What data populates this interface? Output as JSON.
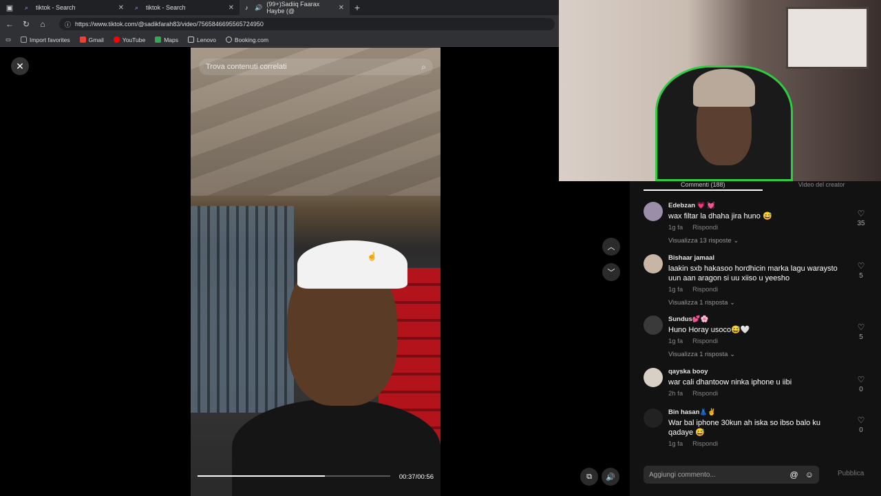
{
  "browser": {
    "tabs": [
      {
        "label": "tiktok - Search",
        "icon": "search-icon"
      },
      {
        "label": "tiktok - Search",
        "icon": "search-icon"
      },
      {
        "label": "(99+)Sadiiq Faarax Haybe (@",
        "icon": "tiktok-icon"
      }
    ],
    "url": "https://www.tiktok.com/@sadikfarah83/video/7565846695565724950",
    "bookmarks": [
      "Import favorites",
      "Gmail",
      "YouTube",
      "Maps",
      "Lenovo",
      "Booking.com"
    ]
  },
  "video": {
    "search_placeholder": "Trova contenuti correlati",
    "time": "00:37/00:56",
    "progress": 0.66
  },
  "comments_panel": {
    "tabs": [
      "Commenti (188)",
      "Video del creator"
    ],
    "comments": [
      {
        "user": "Edebzan 💗 💓",
        "text": "wax filtar la dhaha jira huno 😅",
        "time": "1g fa",
        "reply": "Rispondi",
        "replies": "Visualizza 13 risposte ⌄",
        "likes": "35"
      },
      {
        "user": "Bishaar jamaal",
        "text": "laakin sxb hakasoo hordhicin marka lagu waraysto uun aan aragon si uu xiiso u yeesho",
        "time": "1g fa",
        "reply": "Rispondi",
        "replies": "Visualizza 1 risposta ⌄",
        "likes": "5"
      },
      {
        "user": "Sundus💕🌸",
        "text": "Huno Horay usoco😅🤍",
        "time": "1g fa",
        "reply": "Rispondi",
        "replies": "Visualizza 1 risposta ⌄",
        "likes": "5"
      },
      {
        "user": "qayska booy",
        "text": "war cali dhantoow ninka iphone u iibi",
        "time": "2h fa",
        "reply": "Rispondi",
        "replies": "",
        "likes": "0"
      },
      {
        "user": "Bin hasan👗✌",
        "text": "War bal iphone 30kun ah iska so ibso balo ku qadaye 😅",
        "time": "1g fa",
        "reply": "Rispondi",
        "replies": "",
        "likes": "0"
      }
    ],
    "composer_placeholder": "Aggiungi commento...",
    "publish_label": "Pubblica"
  }
}
